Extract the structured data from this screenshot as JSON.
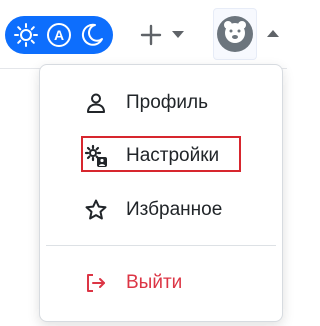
{
  "topbar": {
    "mode_toggle": {
      "options": [
        {
          "name": "light",
          "icon": "sun-icon"
        },
        {
          "name": "auto",
          "icon": "auto-icon",
          "glyph": "A"
        },
        {
          "name": "dark",
          "icon": "moon-icon"
        }
      ],
      "accent": "#0d6efd"
    },
    "add_menu": {
      "icon": "plus-icon"
    },
    "user_menu": {
      "avatar_icon": "bear-avatar-icon"
    }
  },
  "dropdown": {
    "items": [
      {
        "id": "profile",
        "label": "Профиль",
        "icon": "person-icon"
      },
      {
        "id": "settings",
        "label": "Настройки",
        "icon": "user-gear-icon",
        "highlighted": true
      },
      {
        "id": "favorites",
        "label": "Избранное",
        "icon": "star-icon"
      },
      {
        "id": "logout",
        "label": "Выйти",
        "icon": "logout-icon"
      }
    ],
    "highlight_color": "#d7262e",
    "logout_color": "#dc3545"
  }
}
